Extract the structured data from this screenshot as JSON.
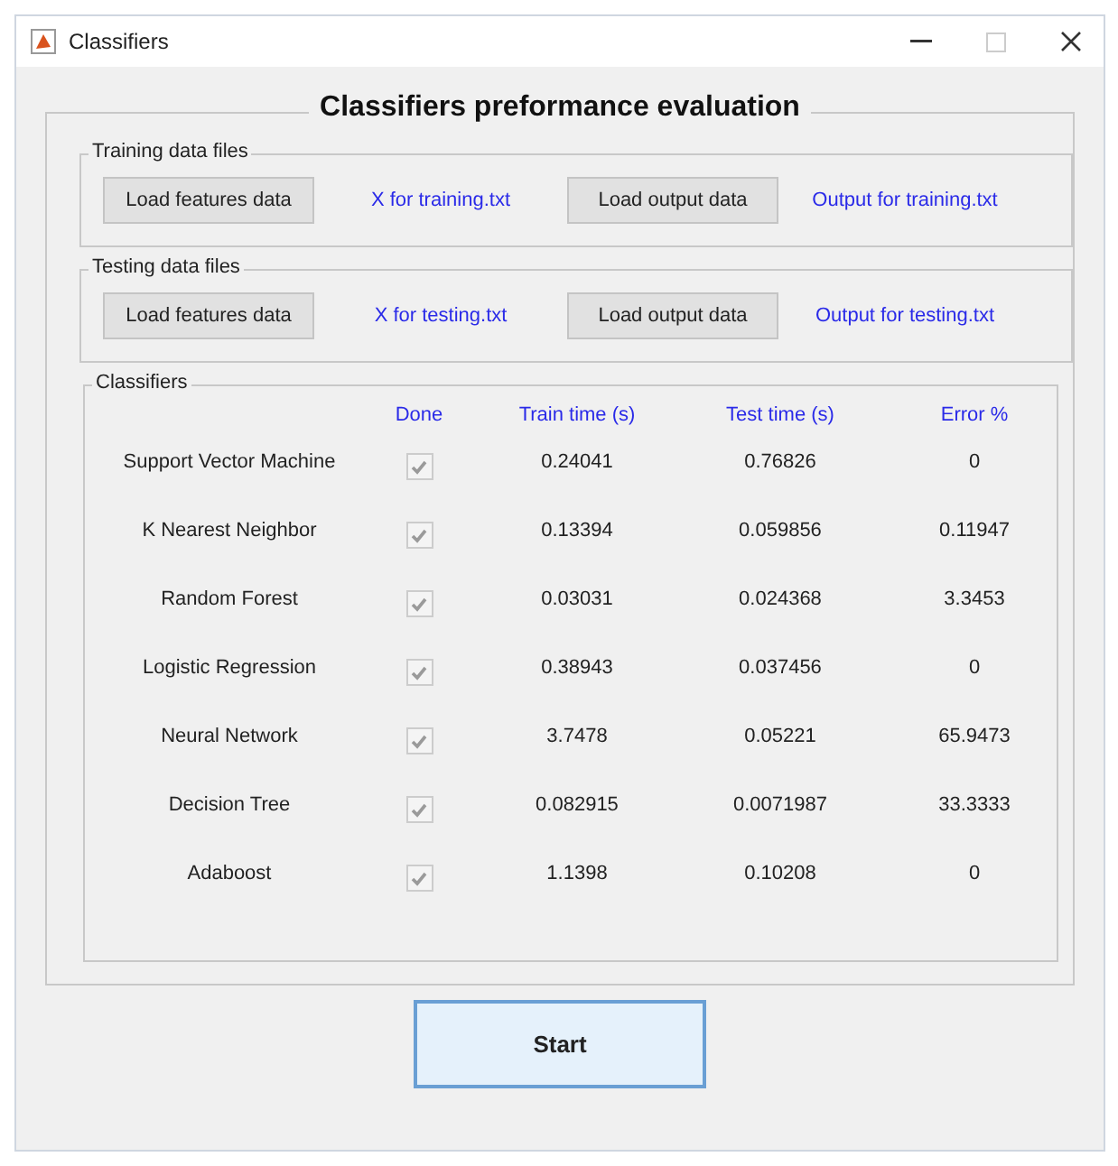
{
  "window": {
    "title": "Classifiers"
  },
  "panel": {
    "title": "Classifiers preformance evaluation"
  },
  "file_groups": [
    {
      "title": "Training data files",
      "features_button": "Load features data",
      "features_file": "X for training.txt",
      "output_button": "Load output data",
      "output_file": "Output for training.txt"
    },
    {
      "title": "Testing data files",
      "features_button": "Load features data",
      "features_file": "X for testing.txt",
      "output_button": "Load output data",
      "output_file": "Output for testing.txt"
    }
  ],
  "classifiers": {
    "title": "Classifiers",
    "columns": [
      "Done",
      "Train time (s)",
      "Test time (s)",
      "Error %"
    ],
    "rows": [
      {
        "name": "Support Vector Machine",
        "checked": true,
        "disabled": true,
        "train_time": "0.24041",
        "test_time": "0.76826",
        "error": "0"
      },
      {
        "name": "K Nearest Neighbor",
        "checked": true,
        "disabled": true,
        "train_time": "0.13394",
        "test_time": "0.059856",
        "error": "0.11947"
      },
      {
        "name": "Random Forest",
        "checked": true,
        "disabled": true,
        "train_time": "0.03031",
        "test_time": "0.024368",
        "error": "3.3453"
      },
      {
        "name": "Logistic Regression",
        "checked": true,
        "disabled": true,
        "train_time": "0.38943",
        "test_time": "0.037456",
        "error": "0"
      },
      {
        "name": "Neural Network",
        "checked": true,
        "disabled": true,
        "train_time": "3.7478",
        "test_time": "0.05221",
        "error": "65.9473"
      },
      {
        "name": "Decision Tree",
        "checked": true,
        "disabled": true,
        "train_time": "0.082915",
        "test_time": "0.0071987",
        "error": "33.3333"
      },
      {
        "name": "Adaboost",
        "checked": true,
        "disabled": true,
        "train_time": "1.1398",
        "test_time": "0.10208",
        "error": "0"
      }
    ]
  },
  "start_button": "Start"
}
